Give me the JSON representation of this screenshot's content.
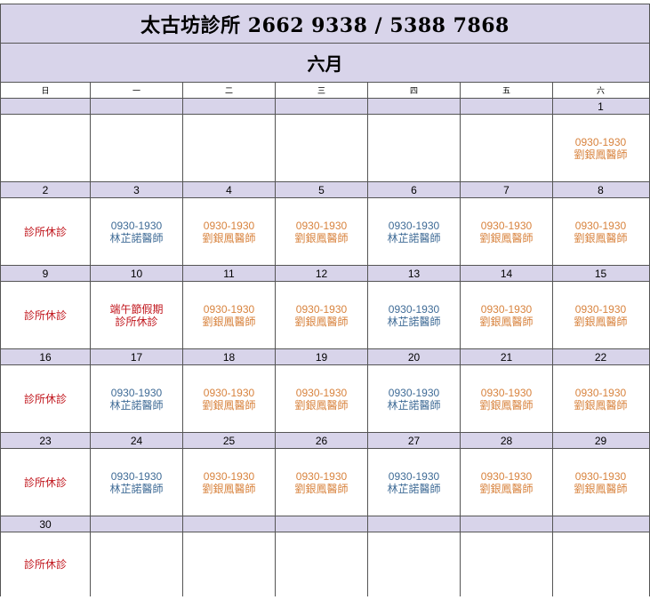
{
  "header": {
    "title": "太古坊診所 2662 9338 / 5388 7868",
    "month": "六月"
  },
  "weekdays": [
    "日",
    "一",
    "二",
    "三",
    "四",
    "五",
    "六"
  ],
  "colors": {
    "header_bg": "#d8d4ea",
    "doctor_lin": "#3f6b96",
    "doctor_lau": "#d8833e",
    "closed": "#c0141b"
  },
  "weeks": [
    {
      "dates": [
        "",
        "",
        "",
        "",
        "",
        "",
        "1"
      ],
      "cells": [
        [],
        [],
        [],
        [],
        [],
        [],
        [
          {
            "text": "0930-1930",
            "color": "orange"
          },
          {
            "text": "劉銀鳳醫師",
            "color": "orange"
          }
        ]
      ]
    },
    {
      "dates": [
        "2",
        "3",
        "4",
        "5",
        "6",
        "7",
        "8"
      ],
      "cells": [
        [
          {
            "text": "診所休診",
            "color": "red"
          }
        ],
        [
          {
            "text": "0930-1930",
            "color": "blue"
          },
          {
            "text": "林芷諾醫師",
            "color": "blue"
          }
        ],
        [
          {
            "text": "0930-1930",
            "color": "orange"
          },
          {
            "text": "劉銀鳳醫師",
            "color": "orange"
          }
        ],
        [
          {
            "text": "0930-1930",
            "color": "orange"
          },
          {
            "text": "劉銀鳳醫師",
            "color": "orange"
          }
        ],
        [
          {
            "text": "0930-1930",
            "color": "blue"
          },
          {
            "text": "林芷諾醫師",
            "color": "blue"
          }
        ],
        [
          {
            "text": "0930-1930",
            "color": "orange"
          },
          {
            "text": "劉銀鳳醫師",
            "color": "orange"
          }
        ],
        [
          {
            "text": "0930-1930",
            "color": "orange"
          },
          {
            "text": "劉銀鳳醫師",
            "color": "orange"
          }
        ]
      ]
    },
    {
      "dates": [
        "9",
        "10",
        "11",
        "12",
        "13",
        "14",
        "15"
      ],
      "cells": [
        [
          {
            "text": "診所休診",
            "color": "red"
          }
        ],
        [
          {
            "text": "端午節假期",
            "color": "red"
          },
          {
            "text": "診所休診",
            "color": "red"
          }
        ],
        [
          {
            "text": "0930-1930",
            "color": "orange"
          },
          {
            "text": "劉銀鳳醫師",
            "color": "orange"
          }
        ],
        [
          {
            "text": "0930-1930",
            "color": "orange"
          },
          {
            "text": "劉銀鳳醫師",
            "color": "orange"
          }
        ],
        [
          {
            "text": "0930-1930",
            "color": "blue"
          },
          {
            "text": "林芷諾醫師",
            "color": "blue"
          }
        ],
        [
          {
            "text": "0930-1930",
            "color": "orange"
          },
          {
            "text": "劉銀鳳醫師",
            "color": "orange"
          }
        ],
        [
          {
            "text": "0930-1930",
            "color": "orange"
          },
          {
            "text": "劉銀鳳醫師",
            "color": "orange"
          }
        ]
      ]
    },
    {
      "dates": [
        "16",
        "17",
        "18",
        "19",
        "20",
        "21",
        "22"
      ],
      "cells": [
        [
          {
            "text": "診所休診",
            "color": "red"
          }
        ],
        [
          {
            "text": "0930-1930",
            "color": "blue"
          },
          {
            "text": "林芷諾醫師",
            "color": "blue"
          }
        ],
        [
          {
            "text": "0930-1930",
            "color": "orange"
          },
          {
            "text": "劉銀鳳醫師",
            "color": "orange"
          }
        ],
        [
          {
            "text": "0930-1930",
            "color": "orange"
          },
          {
            "text": "劉銀鳳醫師",
            "color": "orange"
          }
        ],
        [
          {
            "text": "0930-1930",
            "color": "blue"
          },
          {
            "text": "林芷諾醫師",
            "color": "blue"
          }
        ],
        [
          {
            "text": "0930-1930",
            "color": "orange"
          },
          {
            "text": "劉銀鳳醫師",
            "color": "orange"
          }
        ],
        [
          {
            "text": "0930-1930",
            "color": "orange"
          },
          {
            "text": "劉銀鳳醫師",
            "color": "orange"
          }
        ]
      ]
    },
    {
      "dates": [
        "23",
        "24",
        "25",
        "26",
        "27",
        "28",
        "29"
      ],
      "cells": [
        [
          {
            "text": "診所休診",
            "color": "red"
          }
        ],
        [
          {
            "text": "0930-1930",
            "color": "blue"
          },
          {
            "text": "林芷諾醫師",
            "color": "blue"
          }
        ],
        [
          {
            "text": "0930-1930",
            "color": "orange"
          },
          {
            "text": "劉銀鳳醫師",
            "color": "orange"
          }
        ],
        [
          {
            "text": "0930-1930",
            "color": "orange"
          },
          {
            "text": "劉銀鳳醫師",
            "color": "orange"
          }
        ],
        [
          {
            "text": "0930-1930",
            "color": "blue"
          },
          {
            "text": "林芷諾醫師",
            "color": "blue"
          }
        ],
        [
          {
            "text": "0930-1930",
            "color": "orange"
          },
          {
            "text": "劉銀鳳醫師",
            "color": "orange"
          }
        ],
        [
          {
            "text": "0930-1930",
            "color": "orange"
          },
          {
            "text": "劉銀鳳醫師",
            "color": "orange"
          }
        ]
      ]
    },
    {
      "dates": [
        "30",
        "",
        "",
        "",
        "",
        "",
        ""
      ],
      "cells": [
        [
          {
            "text": "診所休診",
            "color": "red"
          }
        ],
        [],
        [],
        [],
        [],
        [],
        []
      ]
    }
  ]
}
